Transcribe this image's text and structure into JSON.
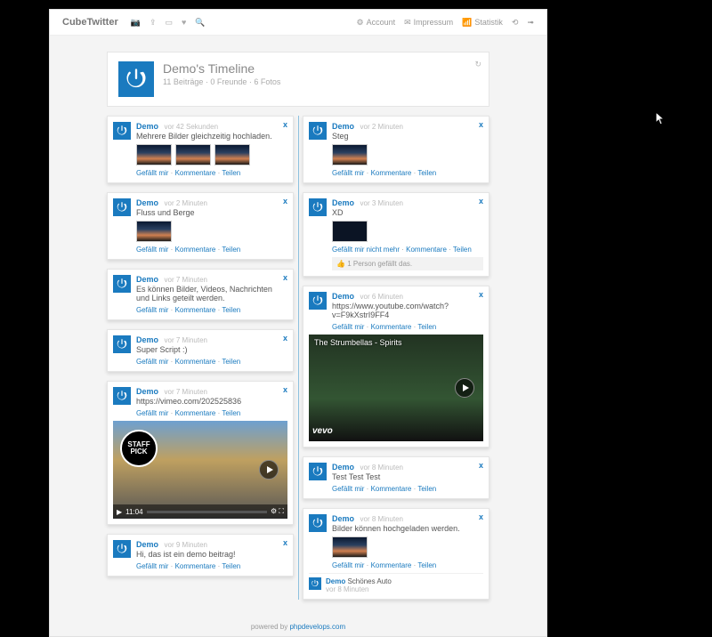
{
  "brand": "CubeTwitter",
  "top_right": {
    "account": "Account",
    "impressum": "Impressum",
    "statistik": "Statistik"
  },
  "profile": {
    "title": "Demo's Timeline",
    "subtitle": "11 Beiträge · 0 Freunde · 6 Fotos"
  },
  "labels": {
    "like": "Gefällt mir",
    "unlike": "Gefällt mir nicht mehr",
    "comments": "Kommentare",
    "share": "Teilen",
    "close": "x"
  },
  "footer": {
    "prefix": "powered by ",
    "link": "phpdevelops.com"
  },
  "left_posts": [
    {
      "author": "Demo",
      "time": "vor 42 Sekunden",
      "text": "Mehrere Bilder gleichzeitig hochladen.",
      "thumbs": 3
    },
    {
      "author": "Demo",
      "time": "vor 2 Minuten",
      "text": "Fluss und Berge",
      "thumbs": 1
    },
    {
      "author": "Demo",
      "time": "vor 7 Minuten",
      "text": "Es können Bilder, Videos, Nachrichten und Links geteilt werden."
    },
    {
      "author": "Demo",
      "time": "vor 7 Minuten",
      "text": "Super Script :)"
    },
    {
      "author": "Demo",
      "time": "vor 7 Minuten",
      "text": "https://vimeo.com/202525836",
      "vimeo": true,
      "duration": "11:04"
    },
    {
      "author": "Demo",
      "time": "vor 9 Minuten",
      "text": "Hi, das ist ein demo beitrag!"
    }
  ],
  "right_posts": [
    {
      "author": "Demo",
      "time": "vor 2 Minuten",
      "text": "Steg",
      "thumbs": 1
    },
    {
      "author": "Demo",
      "time": "vor 3 Minuten",
      "text": "XD",
      "thumbs": 1,
      "dark": true,
      "unlike": true,
      "feedback": "1 Person gefällt das."
    },
    {
      "author": "Demo",
      "time": "vor 6 Minuten",
      "text": "https://www.youtube.com/watch?v=F9kXstrI9FF4",
      "youtube": true,
      "video_title": "The Strumbellas - Spirits"
    },
    {
      "author": "Demo",
      "time": "vor 8 Minuten",
      "text": "Test Test Test"
    },
    {
      "author": "Demo",
      "time": "vor 8 Minuten",
      "text": "Bilder können hochgeladen werden.",
      "thumbs": 1,
      "comment": {
        "author": "Demo",
        "text": "Schönes Auto",
        "time": "vor 8 Minuten"
      }
    }
  ]
}
